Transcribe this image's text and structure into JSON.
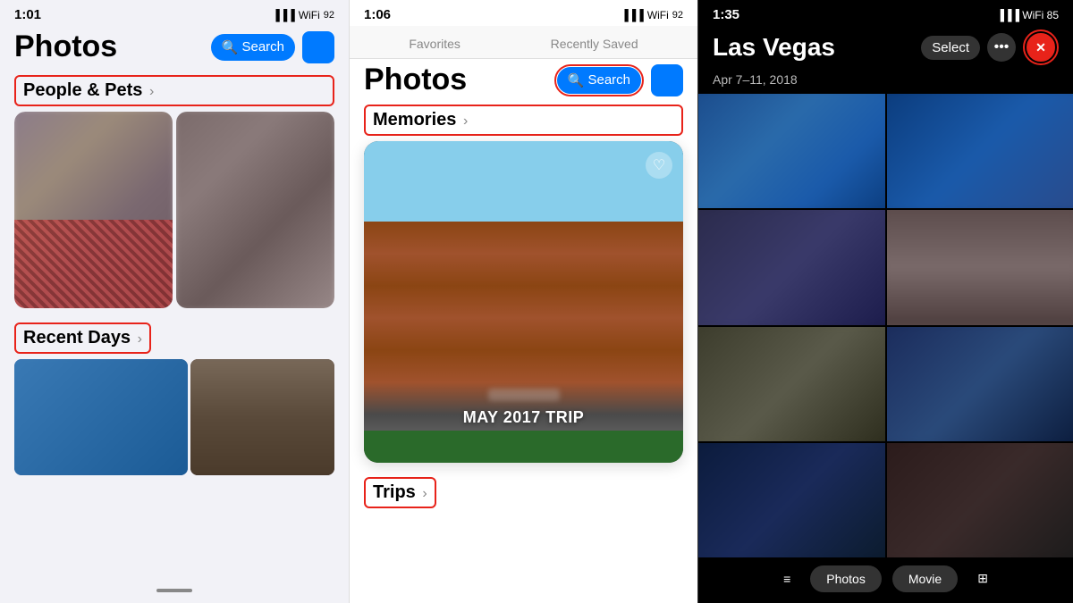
{
  "panel1": {
    "status": {
      "time": "1:01",
      "battery": "92",
      "signal": "●●●",
      "wifi": "WiFi"
    },
    "header": {
      "title": "Photos",
      "search_label": "Search",
      "search_icon": "🔍"
    },
    "people_pets": {
      "label": "People & Pets",
      "chevron": "›"
    },
    "recent_days": {
      "label": "Recent Days",
      "chevron": "›"
    },
    "scroll_indicator": ""
  },
  "panel2": {
    "status": {
      "time": "1:06",
      "battery": "92"
    },
    "tabs": {
      "favorites": "Favorites",
      "recently_saved": "Recently Saved"
    },
    "header": {
      "title": "Photos",
      "search_label": "Search",
      "search_icon": "🔍"
    },
    "memories": {
      "label": "Memories",
      "chevron": "›",
      "card_title": "MAY 2017 TRIP",
      "heart_icon": "♡"
    },
    "trips": {
      "label": "Trips",
      "chevron": "›"
    }
  },
  "panel3": {
    "status": {
      "time": "1:35",
      "battery": "85"
    },
    "header": {
      "title": "Las Vegas",
      "select_label": "Select",
      "more_icon": "•••",
      "close_icon": "✕"
    },
    "date_range": "Apr 7–11, 2018",
    "bottom_bar": {
      "list_icon": "≡",
      "photos_label": "Photos",
      "movie_label": "Movie",
      "grid_icon": "⊞"
    }
  },
  "annotations": {
    "people_pets_box": "red-outlined box around People & Pets",
    "recent_days_box": "red-outlined box around Recent Days",
    "search_box": "red-outlined box around Search button panel2",
    "close_btn_box": "red-outlined box around close button panel3"
  }
}
